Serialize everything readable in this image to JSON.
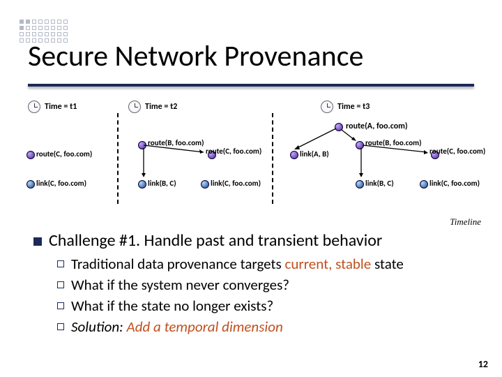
{
  "title": "Secure Network Provenance",
  "timeline_label": "Timeline",
  "page_number": "12",
  "times": {
    "t1": "Time = t1",
    "t2": "Time = t2",
    "t3": "Time = t3"
  },
  "nodes": {
    "routeA": "route(A, foo.com)",
    "routeB": "route(B, foo.com)",
    "routeC": "route(C, foo.com)",
    "linkAB": "link(A, B)",
    "linkBC": "link(B, C)",
    "linkC": "link(C, foo.com)"
  },
  "challenge": {
    "label": "Challenge #1. Handle past and transient behavior",
    "subs": [
      {
        "pre": "Traditional data provenance targets ",
        "accent": "current, stable",
        "post": " state"
      },
      {
        "pre": "What if the system never converges?",
        "accent": "",
        "post": ""
      },
      {
        "pre": "What if the state no longer exists?",
        "accent": "",
        "post": ""
      },
      {
        "italic_pre": "Solution:",
        "italic_accent": " Add a temporal dimension"
      }
    ]
  },
  "chart_data": {
    "type": "table",
    "description": "Provenance graph snapshots at three time points",
    "snapshots": [
      {
        "time": "t1",
        "row1": [
          "route(C, foo.com)"
        ],
        "row2": [
          "link(C, foo.com)"
        ]
      },
      {
        "time": "t2",
        "row1": [
          "route(B, foo.com)",
          "route(C, foo.com)"
        ],
        "row2": [
          "link(B, C)",
          "link(C, foo.com)"
        ],
        "edges": [
          "route(B)->route(C)",
          "route(B)->link(B,C)"
        ]
      },
      {
        "time": "t3",
        "top": "route(A, foo.com)",
        "row1": [
          "link(A, B)",
          "route(B, foo.com)",
          "route(C, foo.com)"
        ],
        "row2": [
          "link(B, C)",
          "link(C, foo.com)"
        ],
        "edges": [
          "route(A)->link(A,B)",
          "route(A)->route(B)",
          "route(B)->route(C)",
          "route(B)->link(B,C)"
        ]
      }
    ]
  }
}
